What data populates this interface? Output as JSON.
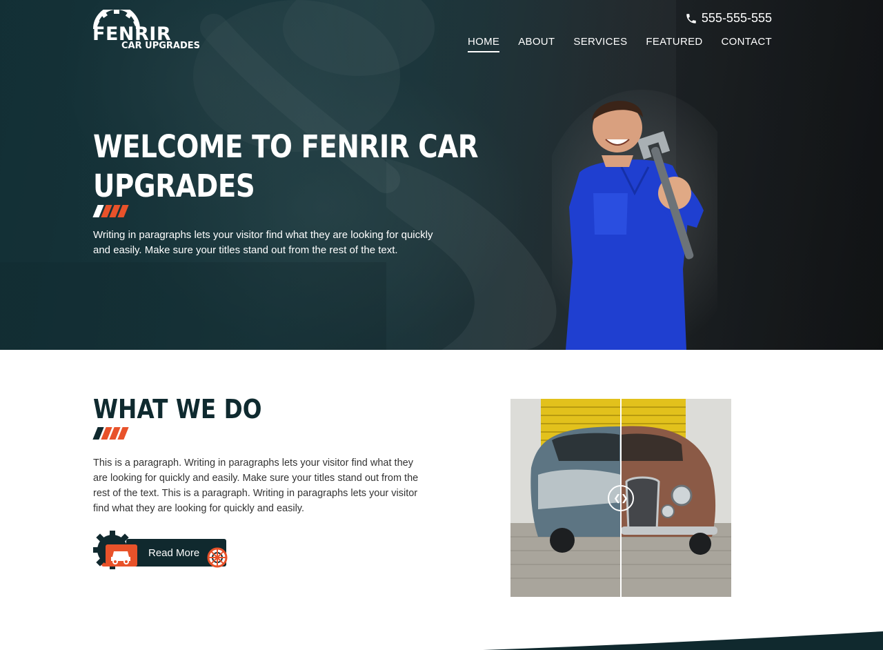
{
  "brand": {
    "name": "FENRIR",
    "tagline": "CAR UPGRADES"
  },
  "header": {
    "phone": "555-555-555",
    "nav": [
      {
        "label": "HOME",
        "active": true
      },
      {
        "label": "ABOUT",
        "active": false
      },
      {
        "label": "SERVICES",
        "active": false
      },
      {
        "label": "FEATURED",
        "active": false
      },
      {
        "label": "CONTACT",
        "active": false
      }
    ]
  },
  "hero": {
    "title_line1": "WELCOME TO FENRIR CAR",
    "title_line2": "UPGRADES",
    "text": "Writing in paragraphs lets your visitor find what they are looking for quickly and easily. Make sure your titles stand out from the rest of the text."
  },
  "what_we_do": {
    "title": "WHAT WE DO",
    "text": "This is a paragraph. Writing in paragraphs lets your visitor find what they are looking for quickly and easily. Make sure your titles stand out from the rest of the text. This is a paragraph. Writing in paragraphs lets your visitor find what they are looking for quickly and easily.",
    "button_label": "Read More"
  },
  "compare_slider": {
    "position": 0.5
  },
  "colors": {
    "accent": "#e8522a",
    "dark": "#10292e",
    "hero_teal": "#1c3a40",
    "text": "#333333"
  },
  "icons": {
    "phone": "phone-icon",
    "logo": "gear-logo-icon",
    "button_gear": "gear-car-icon",
    "button_wheel": "wheel-icon",
    "handle": "slider-arrows-icon"
  }
}
